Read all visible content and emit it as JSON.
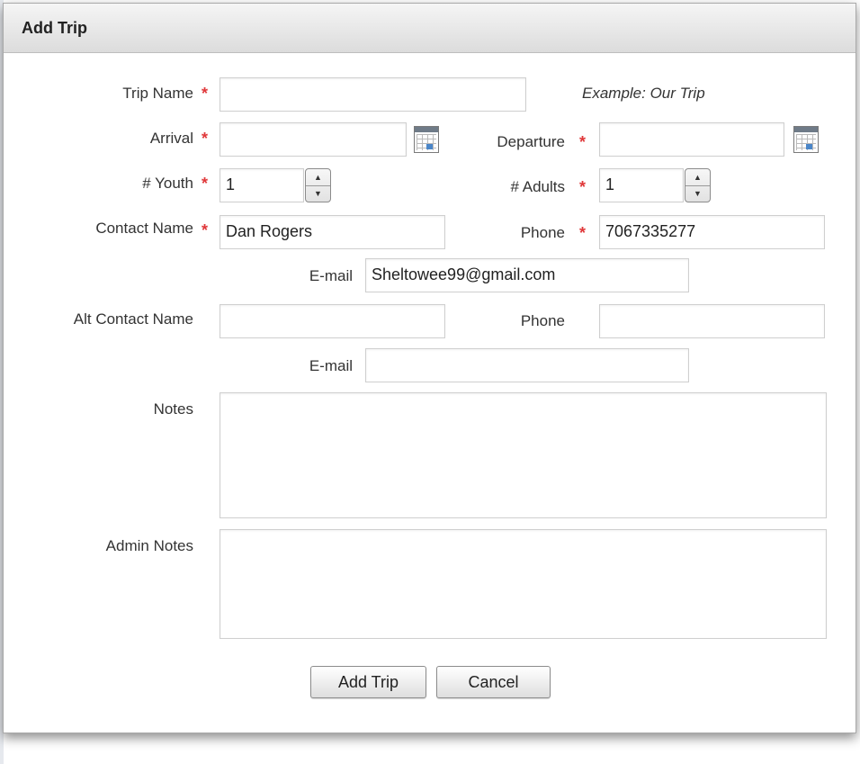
{
  "dialog": {
    "title": "Add Trip",
    "required_marker": "*"
  },
  "fields": {
    "trip_name": {
      "label": "Trip Name",
      "value": "",
      "example": "Example: Our Trip"
    },
    "arrival": {
      "label": "Arrival",
      "value": ""
    },
    "departure": {
      "label": "Departure",
      "value": ""
    },
    "youth": {
      "label": "# Youth",
      "value": "1"
    },
    "adults": {
      "label": "# Adults",
      "value": "1"
    },
    "contact_name": {
      "label": "Contact Name",
      "value": "Dan Rogers"
    },
    "phone": {
      "label": "Phone",
      "value": "7067335277"
    },
    "email": {
      "label": "E-mail",
      "value": "Sheltowee99@gmail.com"
    },
    "alt_contact_name": {
      "label": "Alt Contact Name",
      "value": ""
    },
    "alt_phone": {
      "label": "Phone",
      "value": ""
    },
    "alt_email": {
      "label": "E-mail",
      "value": ""
    },
    "notes": {
      "label": "Notes",
      "value": ""
    },
    "admin_notes": {
      "label": "Admin Notes",
      "value": ""
    }
  },
  "buttons": {
    "add_trip": "Add Trip",
    "cancel": "Cancel"
  },
  "icons": {
    "calendar": "calendar-icon",
    "spinner": "spinner-icon",
    "up_arrow": "▲",
    "down_arrow": "▼"
  },
  "colors": {
    "required": "#e0383a",
    "titlebar": "#dcdcdc"
  }
}
